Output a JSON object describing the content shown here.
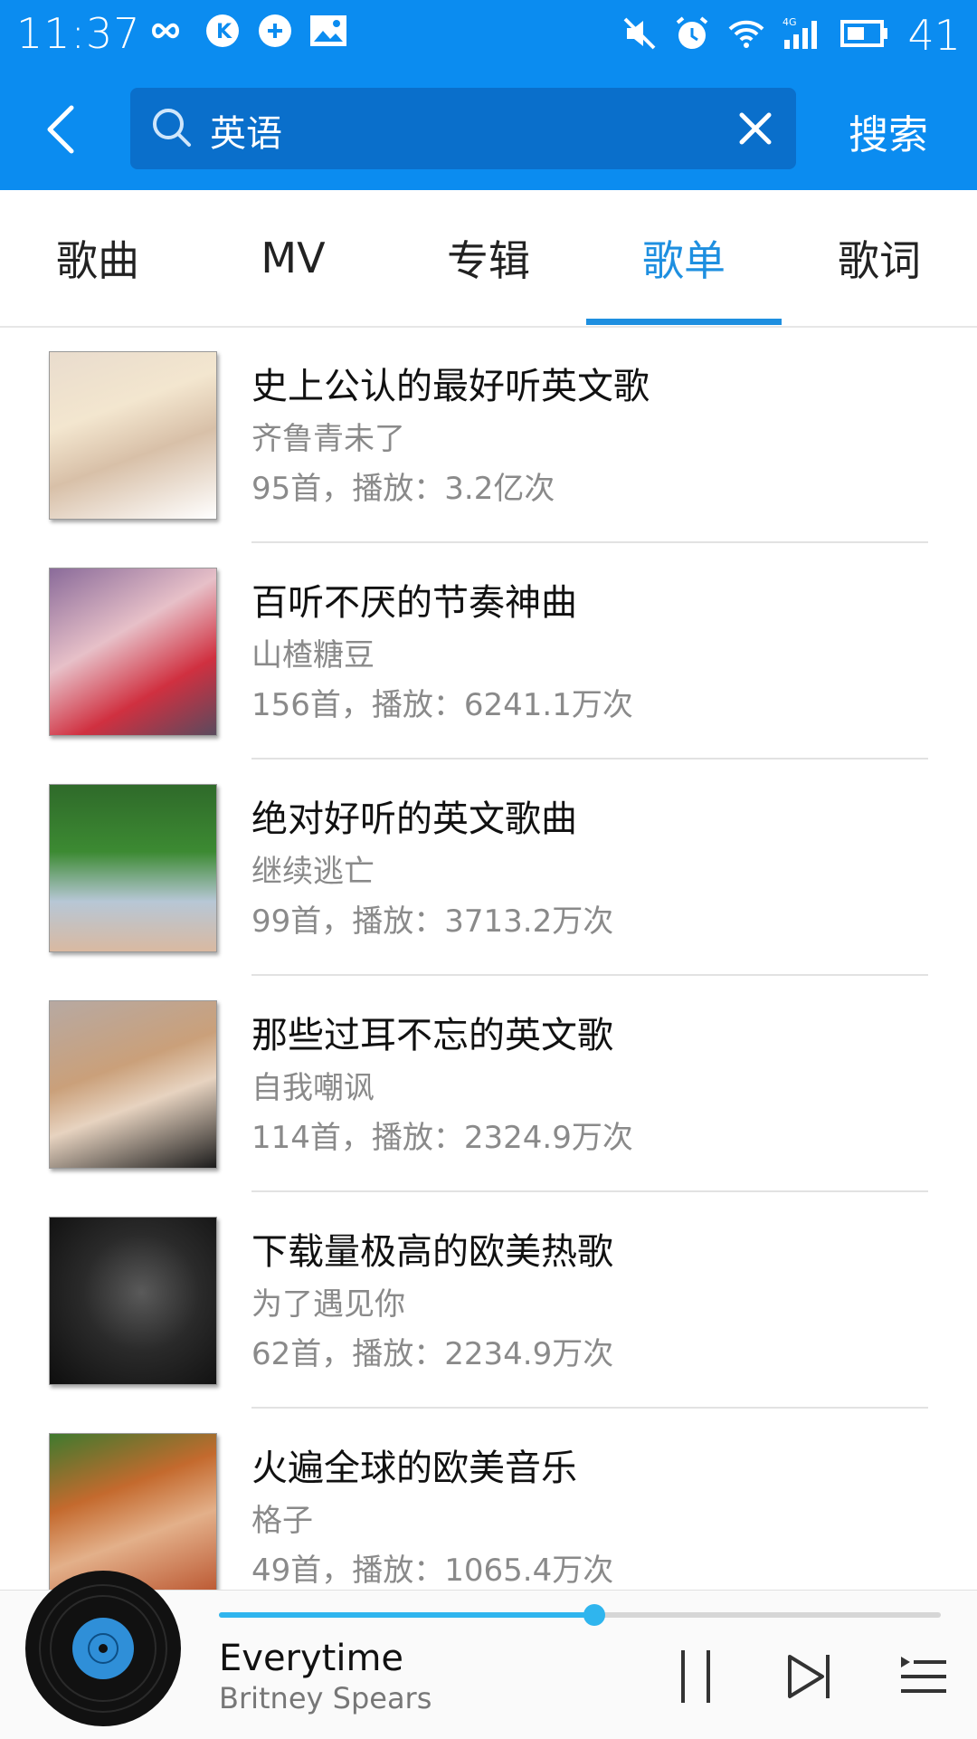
{
  "status_bar": {
    "time": "11:37",
    "battery_level": "41",
    "left_icons": [
      "infinity-icon",
      "k-app-icon",
      "sync-icon",
      "gallery-icon"
    ],
    "right_icons": [
      "mute-icon",
      "alarm-icon",
      "wifi-icon",
      "signal-4g-icon",
      "battery-icon"
    ]
  },
  "search": {
    "query": "英语",
    "submit_label": "搜索"
  },
  "tabs": [
    {
      "label": "歌曲",
      "active": false
    },
    {
      "label": "MV",
      "active": false
    },
    {
      "label": "专辑",
      "active": false
    },
    {
      "label": "歌单",
      "active": true
    },
    {
      "label": "歌词",
      "active": false
    }
  ],
  "playlists": [
    {
      "title": "史上公认的最好听英文歌",
      "author": "齐鲁青未了",
      "stats": "95首，播放：3.2亿次"
    },
    {
      "title": "百听不厌的节奏神曲",
      "author": "山楂糖豆",
      "stats": "156首，播放：6241.1万次"
    },
    {
      "title": "绝对好听的英文歌曲",
      "author": "继续逃亡",
      "stats": "99首，播放：3713.2万次"
    },
    {
      "title": "那些过耳不忘的英文歌",
      "author": "自我嘲讽",
      "stats": "114首，播放：2324.9万次"
    },
    {
      "title": "下载量极高的欧美热歌",
      "author": "为了遇见你",
      "stats": "62首，播放：2234.9万次"
    },
    {
      "title": "火遍全球的欧美音乐",
      "author": "格子",
      "stats": "49首，播放：1065.4万次"
    }
  ],
  "player": {
    "song_title": "Everytime",
    "artist": "Britney Spears",
    "progress": 0.52
  },
  "colors": {
    "header_blue": "#0b8cf0",
    "search_box_blue": "#0a6fcb",
    "accent_blue": "#1e8fe0",
    "progress_blue": "#2fb5ee"
  }
}
